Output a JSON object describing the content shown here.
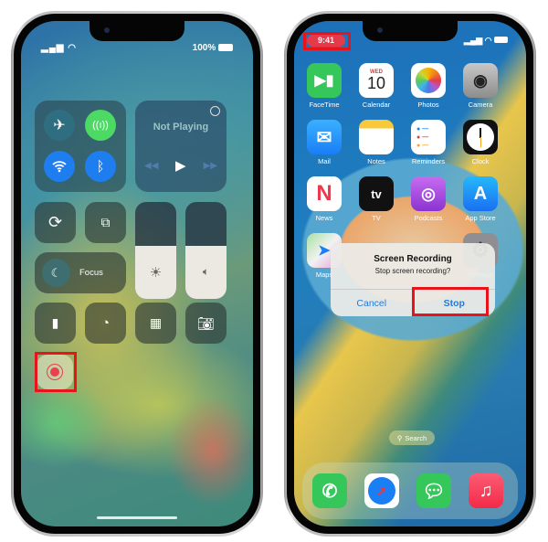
{
  "left_phone": {
    "status": {
      "battery": "100%"
    },
    "media": {
      "title": "Not Playing"
    },
    "focus_label": "Focus",
    "brightness_level": 0.55,
    "volume_level": 0.55,
    "controls": [
      "airplane-mode",
      "cellular-data",
      "wifi",
      "bluetooth",
      "orientation-lock",
      "screen-mirroring",
      "focus",
      "brightness",
      "volume",
      "flashlight",
      "timer",
      "calculator",
      "camera",
      "screen-recording"
    ],
    "highlighted": "screen-recording",
    "colors": {
      "cellular": "#4cd964",
      "wifi": "#1e7ef0",
      "bluetooth": "#1e7ef0",
      "record": "#e8414f",
      "highlight": "#e8141b"
    }
  },
  "right_phone": {
    "status": {
      "time": "9:41"
    },
    "apps": [
      {
        "label": "FaceTime"
      },
      {
        "label": "Calendar",
        "day": "WED",
        "date": "10"
      },
      {
        "label": "Photos"
      },
      {
        "label": "Camera"
      },
      {
        "label": "Mail"
      },
      {
        "label": "Notes"
      },
      {
        "label": "Reminders"
      },
      {
        "label": "Clock"
      },
      {
        "label": "News"
      },
      {
        "label": "TV",
        "glyph": "tv"
      },
      {
        "label": "Podcasts"
      },
      {
        "label": "App Store"
      },
      {
        "label": "Maps"
      },
      {
        "label": "Settings"
      }
    ],
    "alert": {
      "title": "Screen Recording",
      "message": "Stop screen recording?",
      "cancel": "Cancel",
      "stop": "Stop"
    },
    "search_label": "Search",
    "dock": [
      "Phone",
      "Safari",
      "Messages",
      "Music"
    ]
  }
}
